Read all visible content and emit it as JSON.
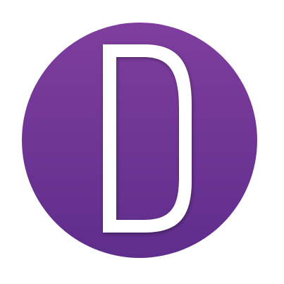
{
  "logo": {
    "letter": "D",
    "colors": {
      "background": "#ffffff",
      "circle_top": "#7f3e9e",
      "circle_bottom": "#5f2d8c",
      "letter": "#ffffff",
      "shadow": "#2a1040"
    }
  }
}
